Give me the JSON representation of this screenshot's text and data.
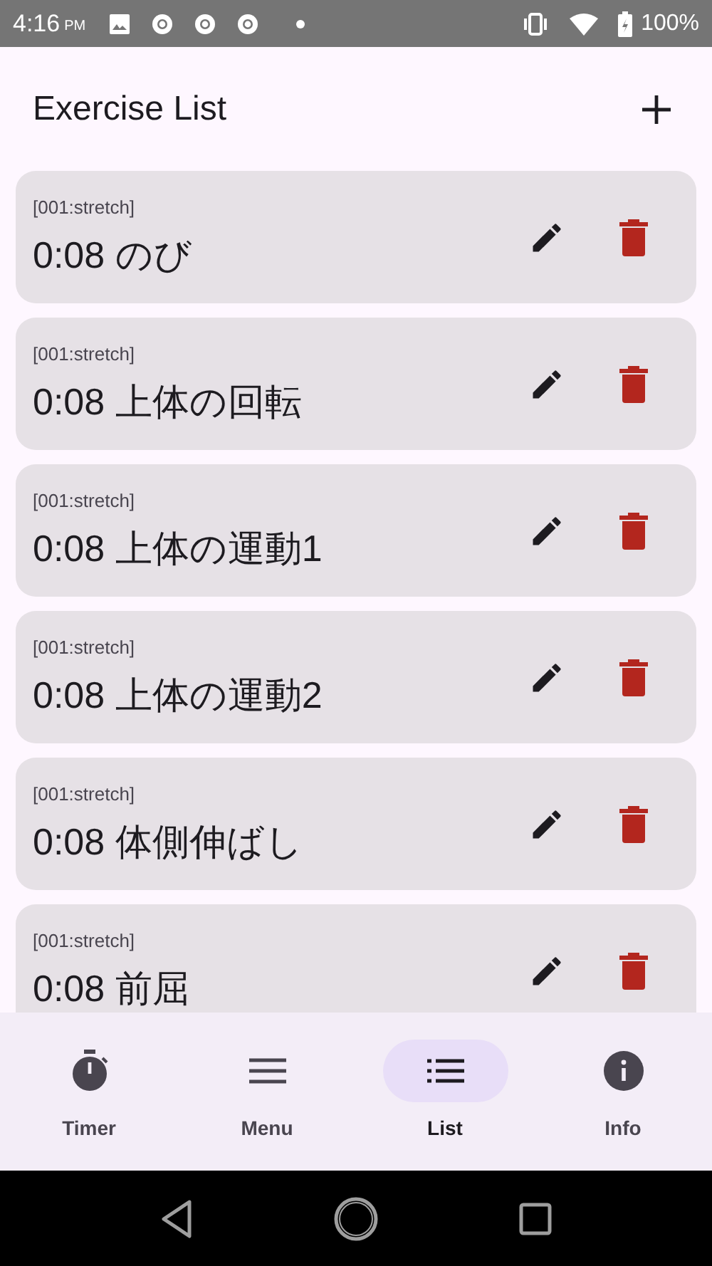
{
  "status_bar": {
    "time": "4:16",
    "period": "PM",
    "battery": "100%"
  },
  "header": {
    "title": "Exercise List"
  },
  "exercises": [
    {
      "tag": "[001:stretch]",
      "title": "0:08 のび"
    },
    {
      "tag": "[001:stretch]",
      "title": "0:08 上体の回転"
    },
    {
      "tag": "[001:stretch]",
      "title": "0:08 上体の運動1"
    },
    {
      "tag": "[001:stretch]",
      "title": "0:08 上体の運動2"
    },
    {
      "tag": "[001:stretch]",
      "title": "0:08 体側伸ばし"
    },
    {
      "tag": "[001:stretch]",
      "title": "0:08 前屈"
    }
  ],
  "nav": [
    {
      "kind": "timer",
      "label": "Timer",
      "selected": false
    },
    {
      "kind": "menu",
      "label": "Menu",
      "selected": false
    },
    {
      "kind": "list",
      "label": "List",
      "selected": true
    },
    {
      "kind": "info",
      "label": "Info",
      "selected": false
    }
  ]
}
